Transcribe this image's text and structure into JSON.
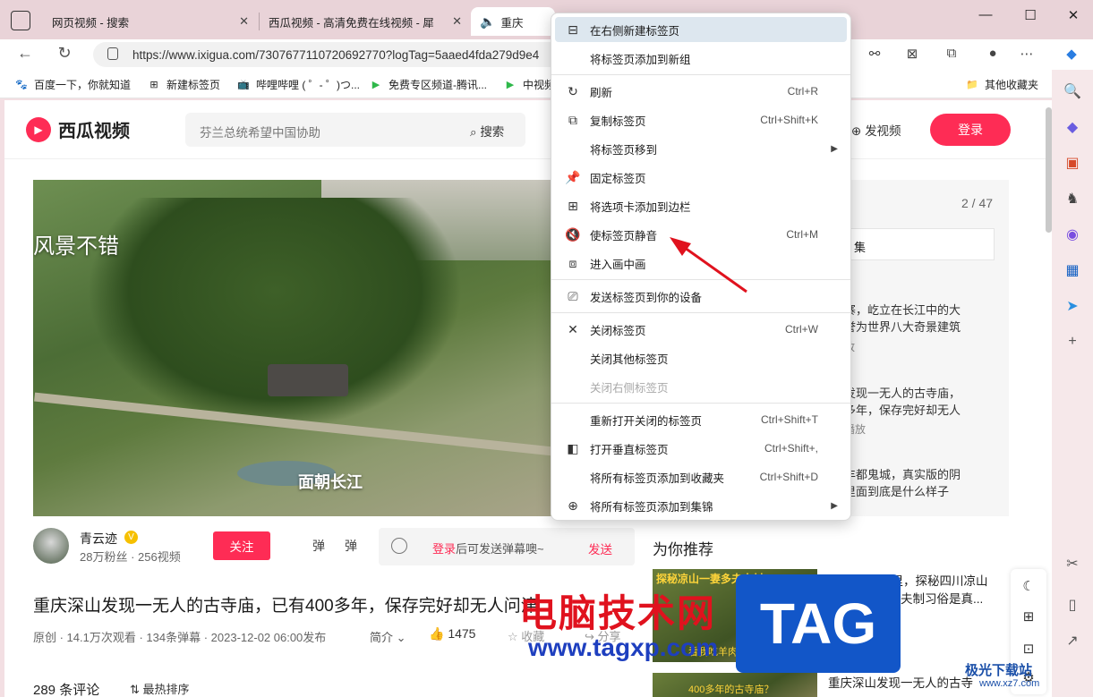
{
  "tabs": [
    {
      "label": "网页视频 - 搜索",
      "favicon": "search-icon"
    },
    {
      "label": "西瓜视频 - 高清免费在线视频 - 犀",
      "favicon": "xigua-icon"
    },
    {
      "label": "重庆",
      "favicon": "xigua-icon"
    }
  ],
  "address_bar": {
    "url": "https://www.ixigua.com/7307677110720692770?logTag=5aaed4fda279d9e4"
  },
  "bookmarks": [
    {
      "label": "百度一下，你就知道"
    },
    {
      "label": "新建标签页"
    },
    {
      "label": "哔哩哔哩 ( ゜- ゜)つ..."
    },
    {
      "label": "免费专区频道-腾讯..."
    },
    {
      "label": "中视频"
    },
    {
      "label": "其他收藏夹"
    }
  ],
  "site": {
    "logo": "西瓜视频",
    "search_placeholder": "芬兰总统希望中国协助",
    "search_button": "搜索",
    "publish": "发视频",
    "login": "登录"
  },
  "video": {
    "overlay_text_1": "风景不错",
    "overlay_text_2": "面朝长江",
    "author_name": "青云迹",
    "author_stats": "28万粉丝 · 256视频",
    "follow": "关注",
    "danmu_toggle_1": "弹",
    "danmu_toggle_2": "弹",
    "danmu_hint_login": "登录",
    "danmu_hint_rest": "后可发送弹幕噢~",
    "send": "发送",
    "title": "重庆深山发现一无人的古寺庙，已有400多年，保存完好却无人问津",
    "meta": "原创 · 14.1万次观看 · 134条弹幕 · 2023-12-02 06:00发布",
    "intro": "简介",
    "likes": "1475",
    "favorite": "收藏",
    "share": "分享",
    "comments": "289 条评论",
    "sort": "最热排序"
  },
  "right_panel": {
    "count": "2 / 47",
    "box_label": "集",
    "items": [
      {
        "line1": "寨，屹立在长江中的大",
        "line2": "誉为世界八大奇景建筑",
        "sub": "放"
      },
      {
        "line1": "发现一无人的古寺庙，",
        "line2": "多年，保存完好却无人",
        "sub": "播放"
      },
      {
        "line1": "丰都鬼城，真实版的阴",
        "line2": "里面到底是什么样子",
        "sub": ""
      }
    ]
  },
  "recommend": {
    "title": "为你推荐",
    "items": [
      {
        "thumb_caption": "探秘凉山一妻多夫古村",
        "thumb_caption_2": "看我吃羊肉",
        "line1": "自驾2000公里，探秘四川凉山",
        "line2": "古村，一妻多夫制习俗是真...",
        "sub": "行"
      },
      {
        "thumb_caption": "400多年的古寺庙？",
        "thumb_caption_2": "",
        "line1": "重庆深山发现一无人的古寺",
        "line2": "",
        "sub": ""
      }
    ]
  },
  "context_menu": {
    "items": [
      {
        "label": "在右侧新建标签页",
        "shortcut": "",
        "icon": "new-tab-icon",
        "highlight": true
      },
      {
        "label": "将标签页添加到新组",
        "shortcut": "",
        "icon": ""
      },
      {
        "label": "刷新",
        "shortcut": "Ctrl+R",
        "icon": "refresh-icon"
      },
      {
        "label": "复制标签页",
        "shortcut": "Ctrl+Shift+K",
        "icon": "duplicate-icon"
      },
      {
        "label": "将标签页移到",
        "shortcut": "",
        "icon": "",
        "submenu": true
      },
      {
        "label": "固定标签页",
        "shortcut": "",
        "icon": "pin-icon"
      },
      {
        "label": "将选项卡添加到边栏",
        "shortcut": "",
        "icon": "sidebar-add-icon"
      },
      {
        "label": "使标签页静音",
        "shortcut": "Ctrl+M",
        "icon": "mute-icon"
      },
      {
        "label": "进入画中画",
        "shortcut": "",
        "icon": "pip-icon"
      },
      {
        "label": "发送标签页到你的设备",
        "shortcut": "",
        "icon": "send-device-icon"
      },
      {
        "label": "关闭标签页",
        "shortcut": "Ctrl+W",
        "icon": "close-icon"
      },
      {
        "label": "关闭其他标签页",
        "shortcut": "",
        "icon": ""
      },
      {
        "label": "关闭右侧标签页",
        "shortcut": "",
        "icon": "",
        "disabled": true
      },
      {
        "label": "重新打开关闭的标签页",
        "shortcut": "Ctrl+Shift+T",
        "icon": ""
      },
      {
        "label": "打开垂直标签页",
        "shortcut": "Ctrl+Shift+,",
        "icon": "vertical-tabs-icon"
      },
      {
        "label": "将所有标签页添加到收藏夹",
        "shortcut": "Ctrl+Shift+D",
        "icon": ""
      },
      {
        "label": "将所有标签页添加到集锦",
        "shortcut": "",
        "icon": "collections-icon",
        "submenu": true
      }
    ]
  },
  "watermark": {
    "cn_text": "电脑技术网",
    "url": "www.tagxp.com",
    "tag": "TAG",
    "site": "极光下载站",
    "site_sub": "www.xz7.com"
  },
  "colors": {
    "accent": "#fe2c55",
    "menu_highlight": "#dde7ef",
    "arrow": "#e0121e"
  }
}
